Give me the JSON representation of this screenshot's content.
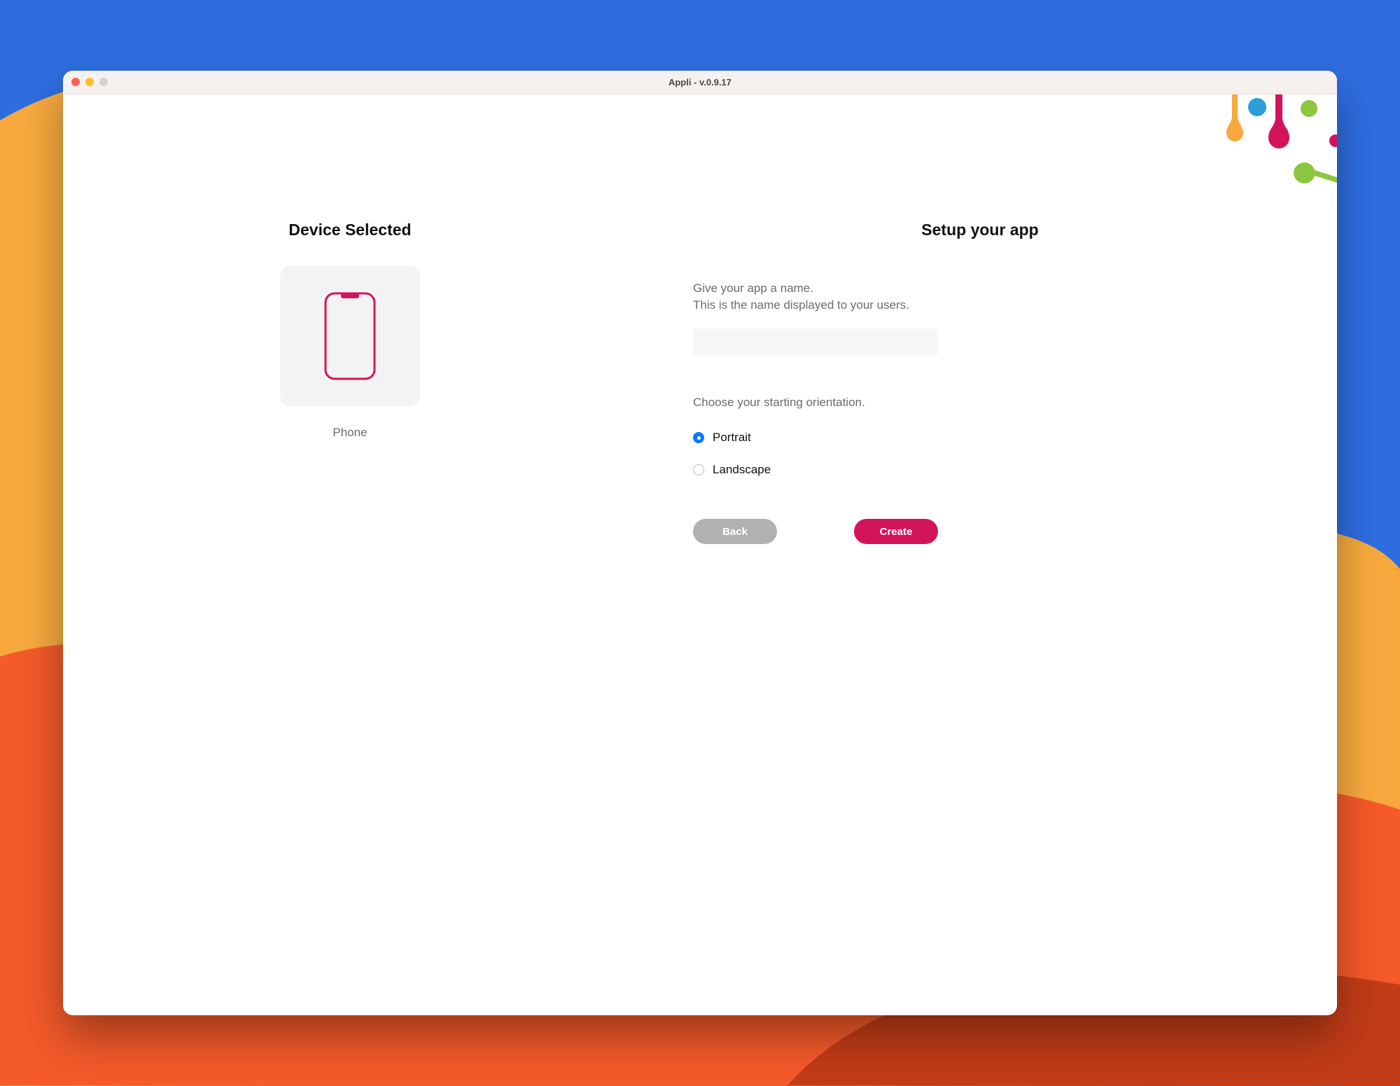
{
  "window": {
    "title": "Appli - v.0.9.17"
  },
  "left": {
    "heading": "Device Selected",
    "device_caption": "Phone"
  },
  "right": {
    "heading": "Setup your app",
    "help_line1": "Give your app a name.",
    "help_line2": "This is the name displayed to your users.",
    "app_name_value": "",
    "orientation_label": "Choose your starting orientation.",
    "orientation_options": {
      "portrait": "Portrait",
      "landscape": "Landscape"
    },
    "orientation_selected": "portrait",
    "back_label": "Back",
    "create_label": "Create"
  },
  "colors": {
    "accent_pink": "#d4145a",
    "radio_blue": "#0a7aff"
  }
}
